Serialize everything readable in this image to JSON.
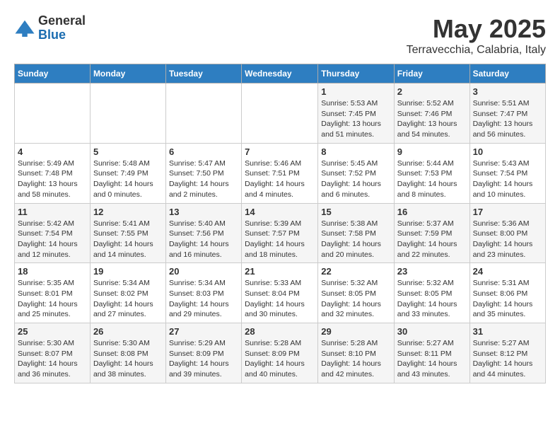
{
  "header": {
    "logo_general": "General",
    "logo_blue": "Blue",
    "month": "May 2025",
    "location": "Terravecchia, Calabria, Italy"
  },
  "weekdays": [
    "Sunday",
    "Monday",
    "Tuesday",
    "Wednesday",
    "Thursday",
    "Friday",
    "Saturday"
  ],
  "weeks": [
    [
      {
        "day": "",
        "info": ""
      },
      {
        "day": "",
        "info": ""
      },
      {
        "day": "",
        "info": ""
      },
      {
        "day": "",
        "info": ""
      },
      {
        "day": "1",
        "info": "Sunrise: 5:53 AM\nSunset: 7:45 PM\nDaylight: 13 hours\nand 51 minutes."
      },
      {
        "day": "2",
        "info": "Sunrise: 5:52 AM\nSunset: 7:46 PM\nDaylight: 13 hours\nand 54 minutes."
      },
      {
        "day": "3",
        "info": "Sunrise: 5:51 AM\nSunset: 7:47 PM\nDaylight: 13 hours\nand 56 minutes."
      }
    ],
    [
      {
        "day": "4",
        "info": "Sunrise: 5:49 AM\nSunset: 7:48 PM\nDaylight: 13 hours\nand 58 minutes."
      },
      {
        "day": "5",
        "info": "Sunrise: 5:48 AM\nSunset: 7:49 PM\nDaylight: 14 hours\nand 0 minutes."
      },
      {
        "day": "6",
        "info": "Sunrise: 5:47 AM\nSunset: 7:50 PM\nDaylight: 14 hours\nand 2 minutes."
      },
      {
        "day": "7",
        "info": "Sunrise: 5:46 AM\nSunset: 7:51 PM\nDaylight: 14 hours\nand 4 minutes."
      },
      {
        "day": "8",
        "info": "Sunrise: 5:45 AM\nSunset: 7:52 PM\nDaylight: 14 hours\nand 6 minutes."
      },
      {
        "day": "9",
        "info": "Sunrise: 5:44 AM\nSunset: 7:53 PM\nDaylight: 14 hours\nand 8 minutes."
      },
      {
        "day": "10",
        "info": "Sunrise: 5:43 AM\nSunset: 7:54 PM\nDaylight: 14 hours\nand 10 minutes."
      }
    ],
    [
      {
        "day": "11",
        "info": "Sunrise: 5:42 AM\nSunset: 7:54 PM\nDaylight: 14 hours\nand 12 minutes."
      },
      {
        "day": "12",
        "info": "Sunrise: 5:41 AM\nSunset: 7:55 PM\nDaylight: 14 hours\nand 14 minutes."
      },
      {
        "day": "13",
        "info": "Sunrise: 5:40 AM\nSunset: 7:56 PM\nDaylight: 14 hours\nand 16 minutes."
      },
      {
        "day": "14",
        "info": "Sunrise: 5:39 AM\nSunset: 7:57 PM\nDaylight: 14 hours\nand 18 minutes."
      },
      {
        "day": "15",
        "info": "Sunrise: 5:38 AM\nSunset: 7:58 PM\nDaylight: 14 hours\nand 20 minutes."
      },
      {
        "day": "16",
        "info": "Sunrise: 5:37 AM\nSunset: 7:59 PM\nDaylight: 14 hours\nand 22 minutes."
      },
      {
        "day": "17",
        "info": "Sunrise: 5:36 AM\nSunset: 8:00 PM\nDaylight: 14 hours\nand 23 minutes."
      }
    ],
    [
      {
        "day": "18",
        "info": "Sunrise: 5:35 AM\nSunset: 8:01 PM\nDaylight: 14 hours\nand 25 minutes."
      },
      {
        "day": "19",
        "info": "Sunrise: 5:34 AM\nSunset: 8:02 PM\nDaylight: 14 hours\nand 27 minutes."
      },
      {
        "day": "20",
        "info": "Sunrise: 5:34 AM\nSunset: 8:03 PM\nDaylight: 14 hours\nand 29 minutes."
      },
      {
        "day": "21",
        "info": "Sunrise: 5:33 AM\nSunset: 8:04 PM\nDaylight: 14 hours\nand 30 minutes."
      },
      {
        "day": "22",
        "info": "Sunrise: 5:32 AM\nSunset: 8:05 PM\nDaylight: 14 hours\nand 32 minutes."
      },
      {
        "day": "23",
        "info": "Sunrise: 5:32 AM\nSunset: 8:05 PM\nDaylight: 14 hours\nand 33 minutes."
      },
      {
        "day": "24",
        "info": "Sunrise: 5:31 AM\nSunset: 8:06 PM\nDaylight: 14 hours\nand 35 minutes."
      }
    ],
    [
      {
        "day": "25",
        "info": "Sunrise: 5:30 AM\nSunset: 8:07 PM\nDaylight: 14 hours\nand 36 minutes."
      },
      {
        "day": "26",
        "info": "Sunrise: 5:30 AM\nSunset: 8:08 PM\nDaylight: 14 hours\nand 38 minutes."
      },
      {
        "day": "27",
        "info": "Sunrise: 5:29 AM\nSunset: 8:09 PM\nDaylight: 14 hours\nand 39 minutes."
      },
      {
        "day": "28",
        "info": "Sunrise: 5:28 AM\nSunset: 8:09 PM\nDaylight: 14 hours\nand 40 minutes."
      },
      {
        "day": "29",
        "info": "Sunrise: 5:28 AM\nSunset: 8:10 PM\nDaylight: 14 hours\nand 42 minutes."
      },
      {
        "day": "30",
        "info": "Sunrise: 5:27 AM\nSunset: 8:11 PM\nDaylight: 14 hours\nand 43 minutes."
      },
      {
        "day": "31",
        "info": "Sunrise: 5:27 AM\nSunset: 8:12 PM\nDaylight: 14 hours\nand 44 minutes."
      }
    ]
  ]
}
